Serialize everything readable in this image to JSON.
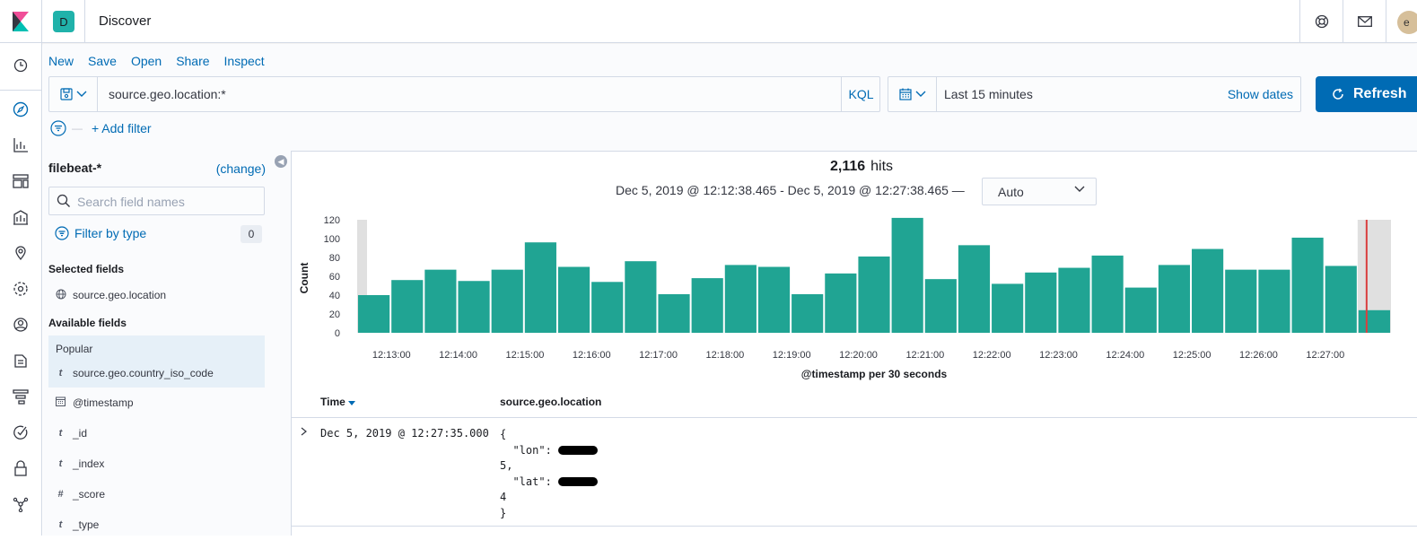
{
  "header": {
    "space_initial": "D",
    "page_title": "Discover",
    "avatar_initial": "e"
  },
  "top_nav": [
    "New",
    "Save",
    "Open",
    "Share",
    "Inspect"
  ],
  "query_bar": {
    "query": "source.geo.location:*",
    "language_label": "KQL"
  },
  "date_picker": {
    "range_label": "Last 15 minutes",
    "show_dates_label": "Show dates"
  },
  "refresh_label": "Refresh",
  "add_filter_label": "+ Add filter",
  "sidebar": {
    "index_pattern": "filebeat-*",
    "change_label": "(change)",
    "search_placeholder": "Search field names",
    "filter_by_type_label": "Filter by type",
    "filter_count": "0",
    "selected_fields_title": "Selected fields",
    "selected_fields": [
      {
        "type_icon": "globe-icon",
        "name": "source.geo.location"
      }
    ],
    "available_fields_title": "Available fields",
    "popular_label": "Popular",
    "popular_fields": [
      {
        "type_icon": "t",
        "name": "source.geo.country_iso_code"
      }
    ],
    "fields": [
      {
        "type_icon": "calendar-icon",
        "name": "@timestamp"
      },
      {
        "type_icon": "t",
        "name": "_id"
      },
      {
        "type_icon": "t",
        "name": "_index"
      },
      {
        "type_icon": "#",
        "name": "_score"
      },
      {
        "type_icon": "t",
        "name": "_type"
      }
    ]
  },
  "results": {
    "hit_count": "2,116",
    "hits_label": "hits",
    "range_text": "Dec 5, 2019 @ 12:12:38.465 - Dec 5, 2019 @ 12:27:38.465 —",
    "interval_value": "Auto",
    "columns": [
      "Time",
      "source.geo.location"
    ],
    "rows": [
      {
        "time": "Dec 5, 2019 @ 12:27:35.000",
        "source_lines": [
          "{",
          "  \"lon\": ",
          "5,",
          "  \"lat\": ",
          "4",
          "}"
        ]
      }
    ]
  },
  "chart_data": {
    "type": "bar",
    "ylabel": "Count",
    "xlabel": "@timestamp per 30 seconds",
    "ylim": [
      0,
      120
    ],
    "yticks": [
      0,
      20,
      40,
      60,
      80,
      100,
      120
    ],
    "xtick_labels": [
      "12:13:00",
      "12:14:00",
      "12:15:00",
      "12:16:00",
      "12:17:00",
      "12:18:00",
      "12:19:00",
      "12:20:00",
      "12:21:00",
      "12:22:00",
      "12:23:00",
      "12:24:00",
      "12:25:00",
      "12:26:00",
      "12:27:00"
    ],
    "values": [
      40,
      56,
      67,
      55,
      67,
      96,
      70,
      54,
      76,
      41,
      58,
      72,
      70,
      41,
      63,
      81,
      122,
      57,
      93,
      52,
      64,
      69,
      82,
      48,
      72,
      89,
      67,
      67,
      101,
      71,
      24
    ],
    "partial_buckets": [
      "first",
      "last"
    ],
    "bar_color": "#20a493",
    "partial_shade": "#e0e0e0",
    "now_marker_color": "#d93f3f"
  }
}
